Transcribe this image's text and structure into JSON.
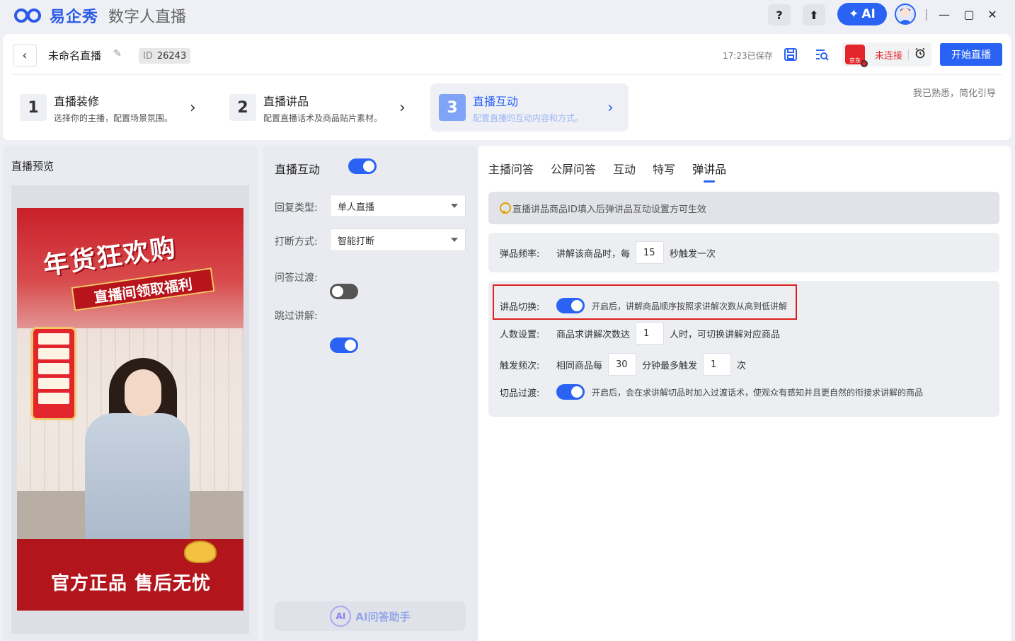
{
  "app": {
    "brand": "易企秀",
    "product": "数字人直播"
  },
  "titlebar": {
    "help_label": "?",
    "upload_label": "⬆",
    "ai_label": "AI",
    "minimize_label": "—",
    "maximize_label": "▢",
    "close_label": "✕",
    "separator": "|"
  },
  "header": {
    "back_label": "‹",
    "project_title": "未命名直播",
    "id_key": "ID",
    "id_value": "26243",
    "saved_text": "17:23已保存",
    "platform_name": "京东",
    "platform_status": "未连接",
    "platform_separator": "|",
    "start_button": "开始直播",
    "skip_guide": "我已熟悉，简化引导"
  },
  "steps": [
    {
      "num": "1",
      "title": "直播装修",
      "desc": "选择你的主播，配置场景氛围。",
      "arrow": "›"
    },
    {
      "num": "2",
      "title": "直播讲品",
      "desc": "配置直播话术及商品贴片素材。",
      "arrow": "›"
    },
    {
      "num": "3",
      "title": "直播互动",
      "desc": "配置直播的互动内容和方式。",
      "arrow": "›"
    }
  ],
  "preview": {
    "title": "直播预览",
    "poster_headline": "年货狂欢购",
    "poster_subline": "直播间领取福利",
    "poster_footer": "官方正品 售后无忧"
  },
  "interaction": {
    "title": "直播互动",
    "title_toggle": true,
    "reply_type_label": "回复类型:",
    "reply_type_value": "单人直播",
    "interrupt_label": "打断方式:",
    "interrupt_value": "智能打断",
    "qa_transition_label": "问答过渡:",
    "qa_transition_on": false,
    "skip_explain_label": "跳过讲解:",
    "skip_explain_on": true,
    "ai_assistant_icon": "AI",
    "ai_assistant_label": "AI问答助手"
  },
  "tabs": [
    "主播问答",
    "公屏问答",
    "互动",
    "特写",
    "弹讲品"
  ],
  "active_tab": "弹讲品",
  "notice": "直播讲品商品ID填入后弹讲品互动设置方可生效",
  "popup_freq": {
    "label": "弹品频率:",
    "prefix": "讲解该商品时，每",
    "value": "15",
    "suffix": "秒触发一次"
  },
  "switch_settings": {
    "switch_label": "讲品切换:",
    "switch_on": true,
    "switch_note": "开启后，讲解商品顺序按照求讲解次数从高到低讲解",
    "count_label": "人数设置:",
    "count_prefix": "商品求讲解次数达",
    "count_value": "1",
    "count_suffix": "人时，可切换讲解对应商品",
    "trigger_label": "触发频次:",
    "trigger_prefix": "相同商品每",
    "trigger_minutes": "30",
    "trigger_mid": "分钟最多触发",
    "trigger_times": "1",
    "trigger_suffix": "次",
    "transition_label": "切品过渡:",
    "transition_on": true,
    "transition_note": "开启后，会在求讲解切品时加入过渡话术，使观众有感知并且更自然的衔接求讲解的商品"
  },
  "colors": {
    "accent": "#2a63f3",
    "danger": "#e02020",
    "jd_red": "#e4262a"
  }
}
